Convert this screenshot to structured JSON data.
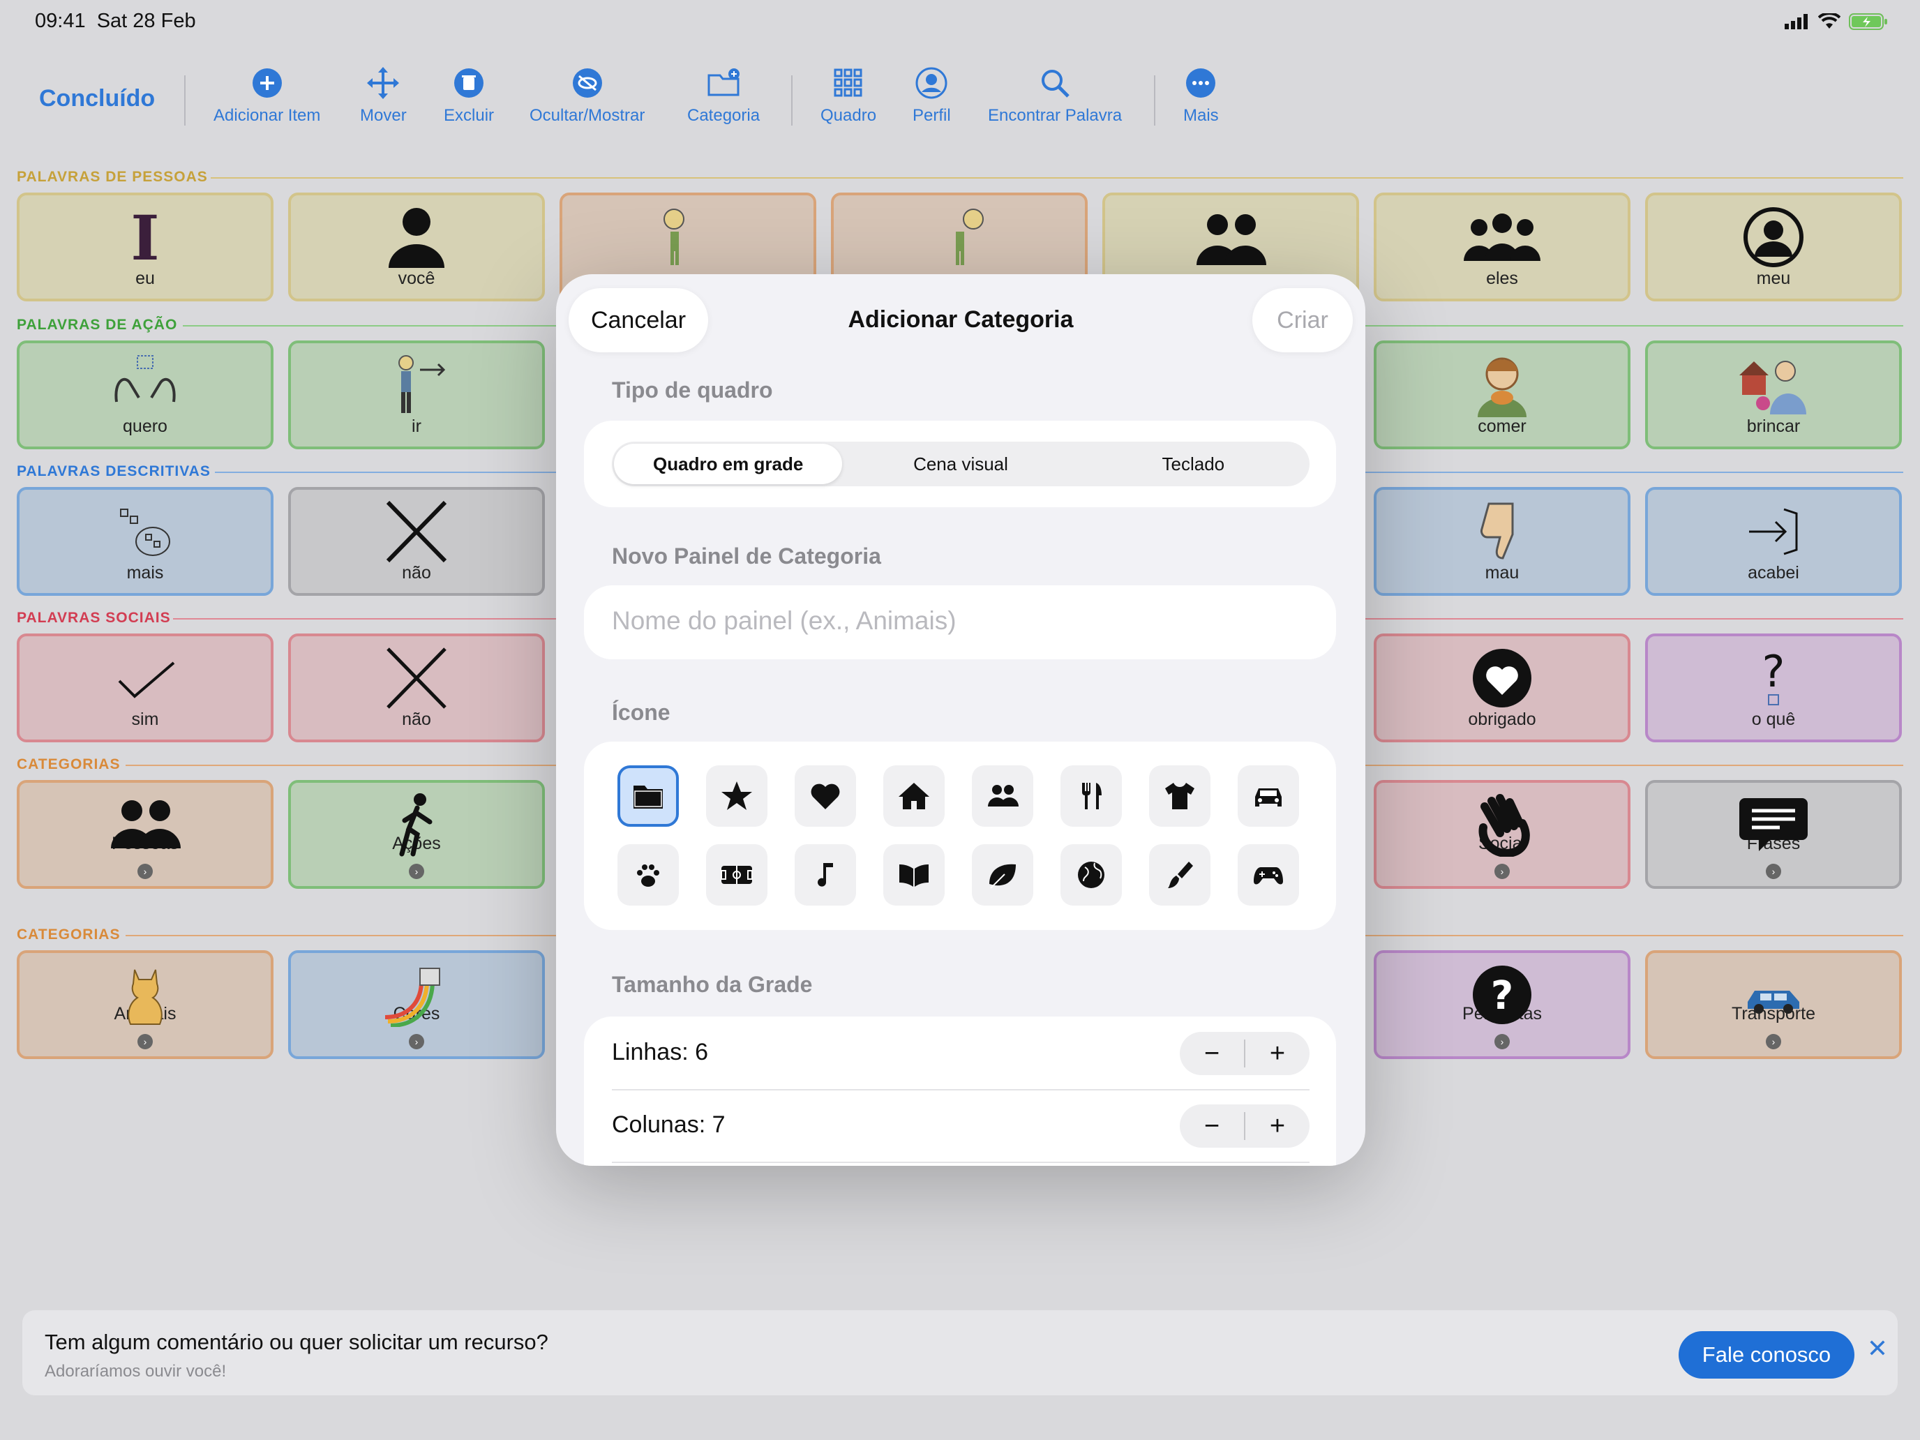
{
  "status": {
    "time": "09:41",
    "date": "Sat 28 Feb"
  },
  "toolbar": {
    "done": "Concluído",
    "items": [
      "Adicionar Item",
      "Mover",
      "Excluir",
      "Ocultar/Mostrar",
      "Categoria",
      "Quadro",
      "Perfil",
      "Encontrar Palavra",
      "Mais"
    ]
  },
  "sections": [
    {
      "label": "PALAVRAS DE PESSOAS",
      "color": "#c6a13a"
    },
    {
      "label": "PALAVRAS DE AÇÃO",
      "color": "#3ea13a"
    },
    {
      "label": "PALAVRAS DESCRITIVAS",
      "color": "#2f78d6"
    },
    {
      "label": "PALAVRAS SOCIAIS",
      "color": "#d23d52"
    },
    {
      "label": "CATEGORIAS",
      "color": "#d98a3a"
    },
    {
      "label": "CATEGORIAS",
      "color": "#d98a3a"
    }
  ],
  "tiles": {
    "people": [
      "eu",
      "você",
      "",
      "",
      "",
      "eles",
      "meu"
    ],
    "action": [
      "quero",
      "ir",
      "comer",
      "brincar"
    ],
    "descriptive": [
      "mais",
      "não",
      "mau",
      "acabei"
    ],
    "social": [
      "sim",
      "não",
      "obrigado",
      "o quê"
    ],
    "categories1": [
      "Pessoas",
      "Ações",
      "Social",
      "Frases"
    ],
    "categories2": [
      "Animais",
      "Cores",
      "Perguntas",
      "Transporte"
    ]
  },
  "modal": {
    "cancel": "Cancelar",
    "title": "Adicionar Categoria",
    "create": "Criar",
    "board_type_label": "Tipo de quadro",
    "board_types": [
      "Quadro em grade",
      "Cena visual",
      "Teclado"
    ],
    "selected_board_type": "Quadro em grade",
    "new_panel_label": "Novo Painel de Categoria",
    "name_placeholder": "Nome do painel (ex., Animais)",
    "icon_label": "Ícone",
    "icons": [
      "folder-icon",
      "star-icon",
      "heart-icon",
      "house-icon",
      "people-icon",
      "fork-knife-icon",
      "tshirt-icon",
      "car-icon",
      "paw-icon",
      "soccer-field-icon",
      "music-note-icon",
      "book-icon",
      "leaf-icon",
      "globe-icon",
      "paintbrush-icon",
      "gamecontroller-icon"
    ],
    "selected_icon": "folder-icon",
    "grid_size_label": "Tamanho da Grade",
    "rows_label": "Linhas: 6",
    "cols_label": "Colunas: 7",
    "minus": "−",
    "plus": "+"
  },
  "banner": {
    "title": "Tem algum comentário ou quer solicitar um recurso?",
    "subtitle": "Adoraríamos ouvir você!",
    "button": "Fale conosco",
    "close": "✕"
  },
  "colors": {
    "accent": "#2f78d6"
  }
}
